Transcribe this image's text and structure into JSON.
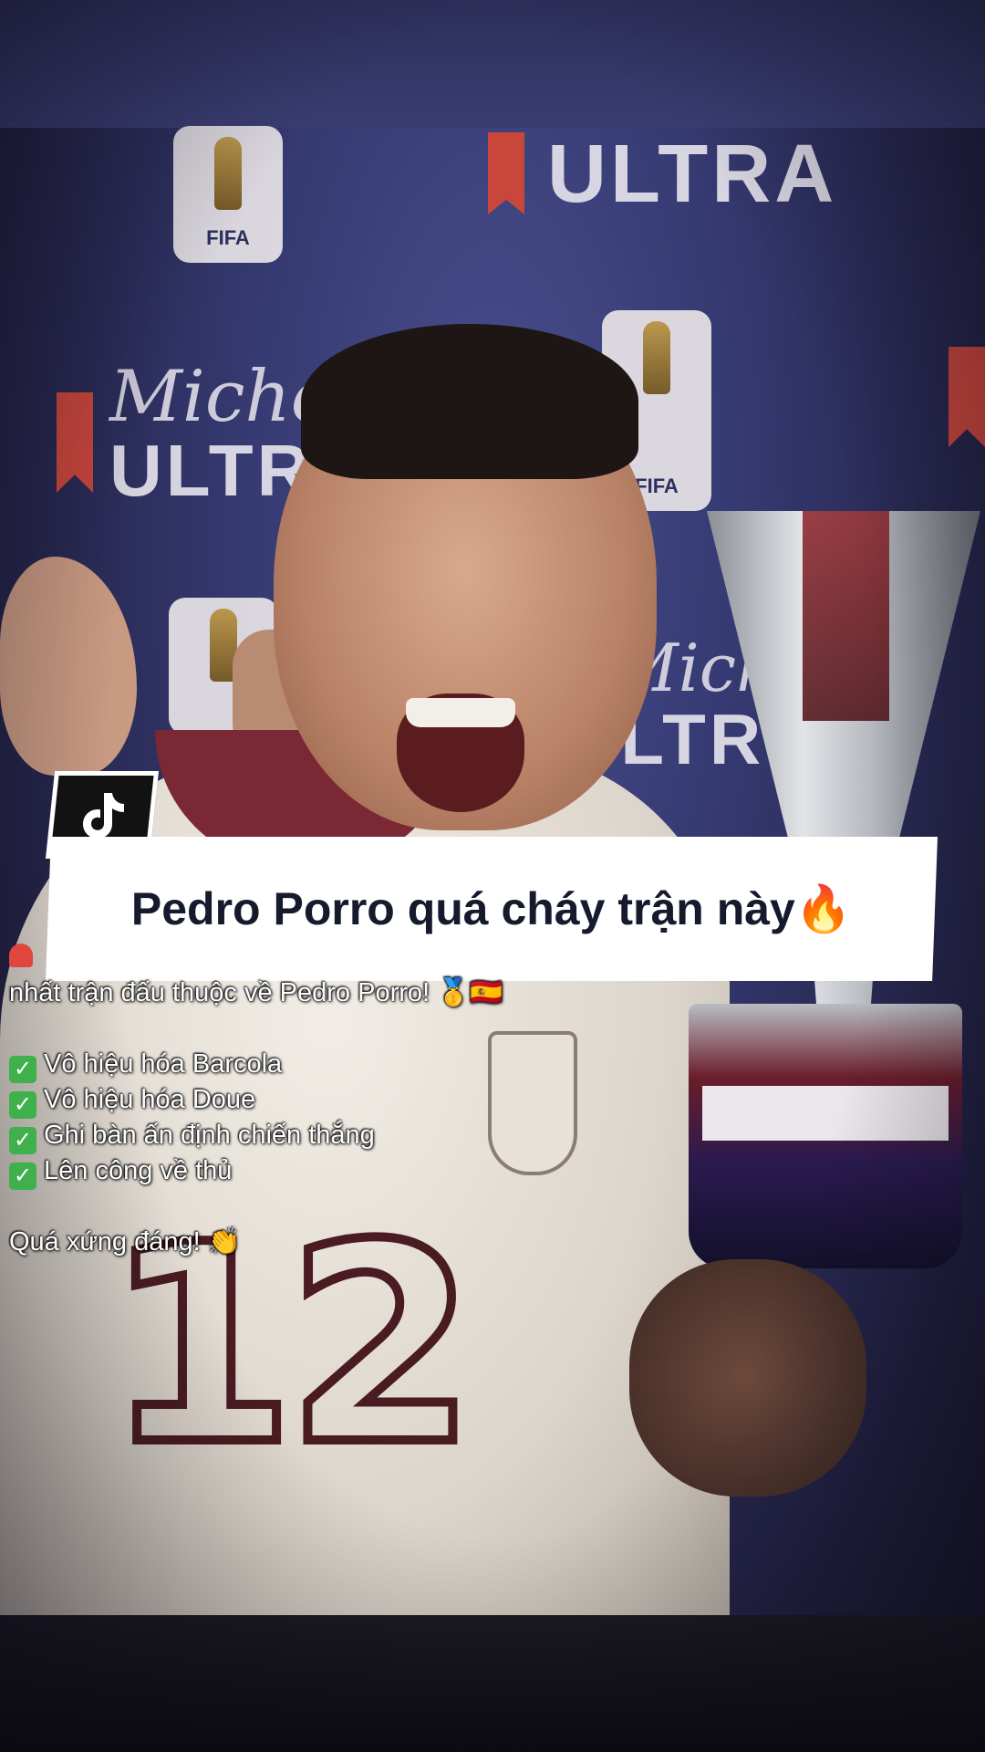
{
  "banner": {
    "title": "Pedro Porro quá cháy trận này🔥"
  },
  "caption": {
    "lead_icon": "siren-icon",
    "intro_line": "nhất trận đấu thuộc về Pedro Porro! 🥇🇪🇸",
    "checklist": [
      "Vô hiệu hóa Barcola",
      "Vô hiệu hóa Doue",
      "Ghi bàn ấn định chiến thắng",
      "Lên công về thủ"
    ],
    "closing": "Quá xứng đáng! 👏"
  },
  "background": {
    "sponsor_1": "ULTRA",
    "sponsor_2": "Michelo",
    "sponsor_3": "ULTR",
    "sponsor_4": "Michel",
    "sponsor_5": "ULTR",
    "fifa": "FIFA",
    "jersey_number": "12"
  },
  "colors": {
    "backdrop": "#363a72",
    "banner_bg": "#ffffff",
    "banner_text": "#151a2c",
    "caption_text": "#ffffff",
    "check_green": "#3fb04b"
  }
}
